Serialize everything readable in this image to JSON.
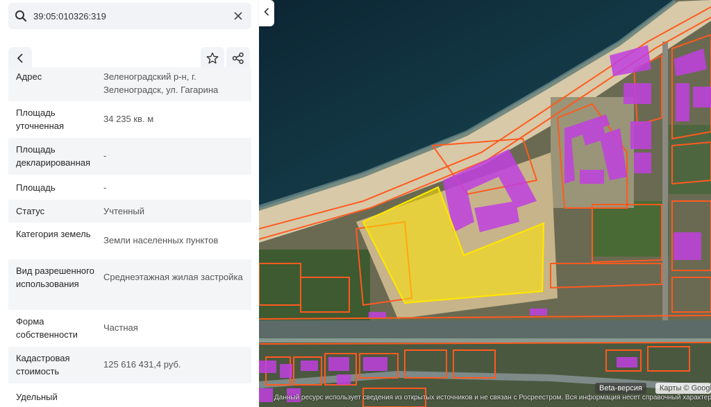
{
  "search": {
    "value": "39:05:010326:319"
  },
  "info_rows": [
    {
      "label": "Адрес",
      "value": "Зеленоградский р-н, г. Зеленоградск, ул. Гагарина"
    },
    {
      "label": "Площадь уточненная",
      "value": "34 235 кв. м"
    },
    {
      "label": "Площадь декларированная",
      "value": "-"
    },
    {
      "label": "Площадь",
      "value": "-"
    },
    {
      "label": "Статус",
      "value": "Учтенный"
    },
    {
      "label": "Категория земель",
      "value": "Земли населенных пунктов"
    },
    {
      "label": "Вид разрешенного использования",
      "value": "Среднеэтажная жилая застройка"
    },
    {
      "label": "Форма собственности",
      "value": "Частная"
    },
    {
      "label": "Кадастровая стоимость",
      "value": "125 616 431,4 руб."
    },
    {
      "label": "Удельный",
      "value": ""
    }
  ],
  "map": {
    "beta_label": "Beta-версия",
    "credit": "Карты © Google",
    "disclaimer": "Данный ресурс использует сведения из открытых источников и не связан с Росреестром. Вся информация несет справочный характер",
    "colors": {
      "parcel_border": "#ff5a1f",
      "selected_parcel": "#ffe600",
      "buildings": "#c040e0",
      "sea": "#0f3040"
    }
  },
  "icons": [
    "search-icon",
    "close-icon",
    "back-icon",
    "star-icon",
    "share-icon",
    "chevron-left-icon"
  ]
}
